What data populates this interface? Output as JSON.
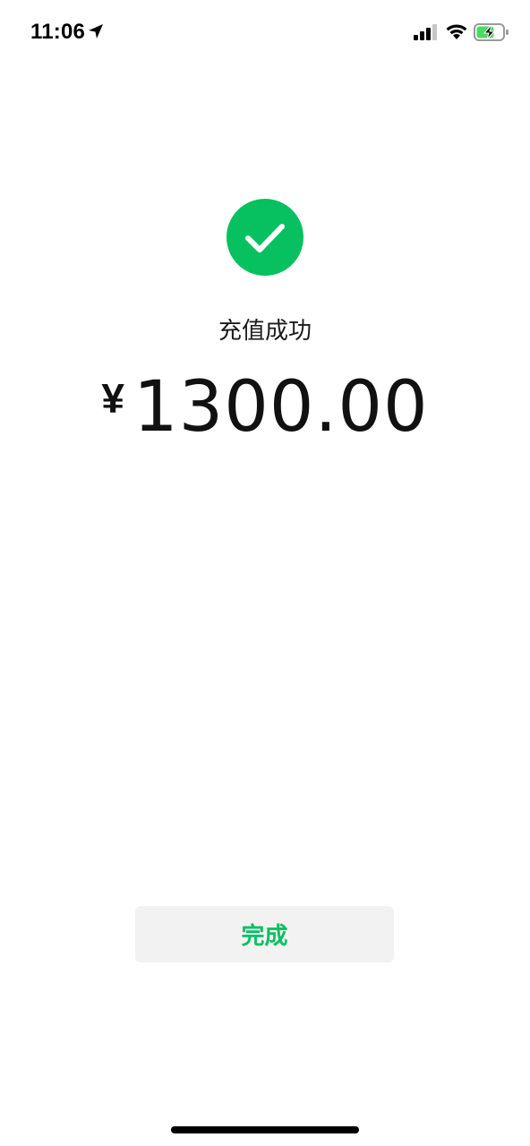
{
  "status_bar": {
    "time": "11:06",
    "icons": [
      "location-arrow-icon",
      "cellular-signal-icon",
      "wifi-icon",
      "battery-charging-icon"
    ]
  },
  "result": {
    "icon": "checkmark-circle-icon",
    "title": "充值成功",
    "currency_symbol": "¥",
    "amount": "1300.00"
  },
  "actions": {
    "done_label": "完成"
  },
  "colors": {
    "success_green": "#07c160",
    "button_background": "#f2f2f2",
    "text_primary": "#111111",
    "battery_green": "#4cd964"
  }
}
